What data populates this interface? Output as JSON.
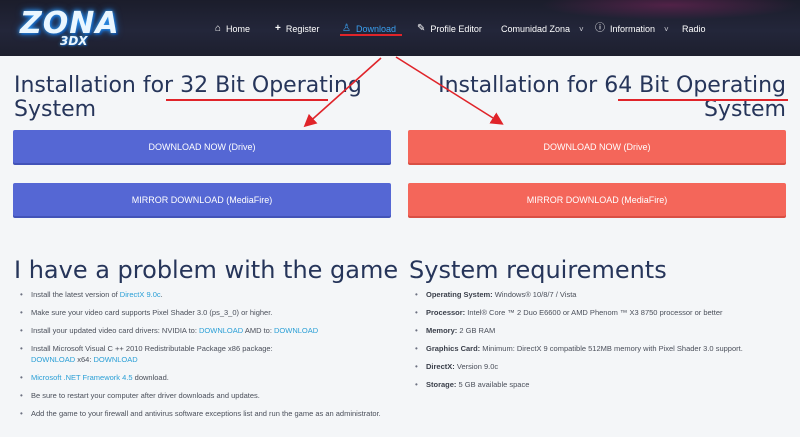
{
  "header": {
    "logo_main": "ZONA",
    "logo_sub": "3DX",
    "nav": [
      {
        "label": "Home",
        "icon": "home-icon",
        "glyph": "⌂"
      },
      {
        "label": "Register",
        "icon": "plus-icon",
        "glyph": "+"
      },
      {
        "label": "Download",
        "icon": "trophy-icon",
        "glyph": "♙",
        "active": true
      },
      {
        "label": "Profile Editor",
        "icon": "pencil-icon",
        "glyph": "✎"
      },
      {
        "label": "Comunidad Zona",
        "icon": "chevron-down-icon",
        "glyph": "˅"
      },
      {
        "label": "Information",
        "icon": "info-icon",
        "glyph": "ⓘ"
      },
      {
        "label": "Radio",
        "icon": "",
        "glyph": ""
      }
    ]
  },
  "left": {
    "title": "Installation for 32 Bit Operating System",
    "download_label": "DOWNLOAD NOW (Drive)",
    "mirror_label": "MIRROR DOWNLOAD (MediaFire)"
  },
  "right": {
    "title": "Installation for 64 Bit Operating System",
    "download_label": "DOWNLOAD NOW (Drive)",
    "mirror_label": "MIRROR DOWNLOAD (MediaFire)"
  },
  "problem": {
    "title": "I have a problem with the game",
    "items": {
      "i1_text": "Install the latest version of ",
      "i1_link": "DirectX 9.0c",
      "i1_end": ".",
      "i2_text": "Make sure your video card supports Pixel Shader 3.0 (ps_3_0) or higher.",
      "i3_text": "Install your updated video card drivers: NVIDIA to: ",
      "i3_link1": "DOWNLOAD",
      "i3_mid": " AMD to: ",
      "i3_link2": "DOWNLOAD",
      "i4_text": "Install Microsoft Visual C ++ 2010 Redistributable Package x86 package:",
      "i4_link1": "DOWNLOAD",
      "i4_mid": " x64: ",
      "i4_link2": "DOWNLOAD",
      "i5_link": "Microsoft .NET Framework 4.5",
      "i5_text": " download.",
      "i6_text": "Be sure to restart your computer after driver downloads and updates.",
      "i7_text": "Add the game to your firewall and antivirus software exceptions list and run the game as an administrator."
    }
  },
  "requirements": {
    "title": "System requirements",
    "items": [
      {
        "key": "Operating System:",
        "value": " Windows® 10/8/7 / Vista"
      },
      {
        "key": "Processor:",
        "value": " Intel® Core ™ 2 Duo E6600 or AMD Phenom ™ X3 8750 processor or better"
      },
      {
        "key": "Memory:",
        "value": " 2 GB RAM"
      },
      {
        "key": "Graphics Card:",
        "value": " Minimum: DirectX 9 compatible 512MB memory with Pixel Shader 3.0 support."
      },
      {
        "key": "DirectX:",
        "value": " Version 9.0c"
      },
      {
        "key": "Storage:",
        "value": " 5 GB available space"
      }
    ]
  },
  "colors": {
    "header_bg": "#23263a",
    "title": "#26355a",
    "blue_button": "#5567d4",
    "red_button": "#f4665a",
    "link": "#2a9fd6",
    "annotation_red": "#e0242a",
    "active_nav": "#3aa0f0"
  }
}
